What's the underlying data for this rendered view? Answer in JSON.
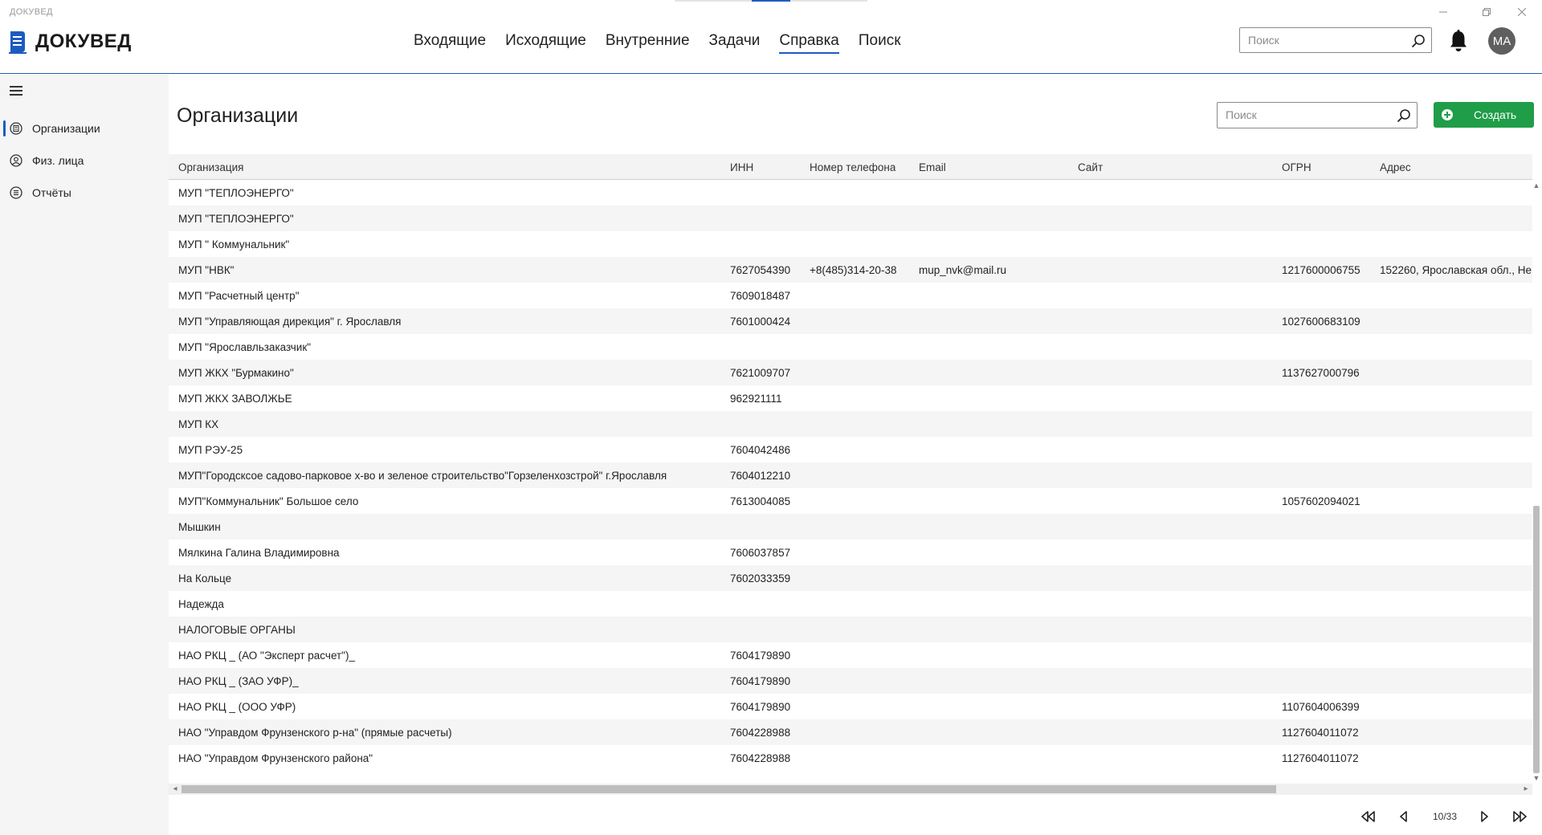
{
  "window": {
    "title": "ДОКУВЕД",
    "controls": [
      "minimize-icon",
      "restore-icon",
      "close-icon"
    ]
  },
  "header": {
    "logo_text": "ДОКУВЕД",
    "nav": [
      {
        "label": "Входящие"
      },
      {
        "label": "Исходящие"
      },
      {
        "label": "Внутренние"
      },
      {
        "label": "Задачи"
      },
      {
        "label": "Справка",
        "active": true
      },
      {
        "label": "Поиск"
      }
    ],
    "search_placeholder": "Поиск",
    "avatar_initials": "МА"
  },
  "sidebar": {
    "items": [
      {
        "label": "Организации",
        "icon": "building-icon",
        "active": true
      },
      {
        "label": "Физ. лица",
        "icon": "person-icon"
      },
      {
        "label": "Отчёты",
        "icon": "list-icon"
      }
    ]
  },
  "page": {
    "title": "Организации",
    "search_placeholder": "Поиск",
    "create_label": "Создать"
  },
  "table": {
    "columns": [
      "Организация",
      "ИНН",
      "Номер телефона",
      "Email",
      "Сайт",
      "ОГРН",
      "Адрес"
    ],
    "rows": [
      [
        "МУП  \"ТЕПЛОЭНЕРГО\"",
        "",
        "",
        "",
        "",
        "",
        ""
      ],
      [
        "МУП  \"ТЕПЛОЭНЕРГО\"",
        "",
        "",
        "",
        "",
        "",
        ""
      ],
      [
        "МУП \" Коммунальник\"",
        "",
        "",
        "",
        "",
        "",
        ""
      ],
      [
        "МУП \"НВК\"",
        "7627054390",
        "+8(485)314-20-38",
        "mup_nvk@mail.ru",
        "",
        "1217600006755",
        "152260, Ярославская обл., Не"
      ],
      [
        "МУП \"Расчетный центр\"",
        "7609018487",
        "",
        "",
        "",
        "",
        ""
      ],
      [
        "МУП \"Управляющая дирекция\" г. Ярославля",
        "7601000424",
        "",
        "",
        "",
        "1027600683109",
        ""
      ],
      [
        "МУП \"Ярославльзаказчик\"",
        "",
        "",
        "",
        "",
        "",
        ""
      ],
      [
        "МУП ЖКХ \"Бурмакино\"",
        "7621009707",
        "",
        "",
        "",
        "1137627000796",
        ""
      ],
      [
        "МУП ЖКХ ЗАВОЛЖЬЕ",
        "962921111",
        "",
        "",
        "",
        "",
        ""
      ],
      [
        "МУП КХ",
        "",
        "",
        "",
        "",
        "",
        ""
      ],
      [
        "МУП РЭУ-25",
        "7604042486",
        "",
        "",
        "",
        "",
        ""
      ],
      [
        "МУП\"Городсксое садово-парковое х-во и зеленое строительство\"Горзеленхозстрой\" г.Ярославля",
        "7604012210",
        "",
        "",
        "",
        "",
        ""
      ],
      [
        "МУП\"Коммунальник\" Большое село",
        "7613004085",
        "",
        "",
        "",
        "1057602094021",
        ""
      ],
      [
        "Мышкин",
        "",
        "",
        "",
        "",
        "",
        ""
      ],
      [
        "Мялкина Галина Владимировна",
        "7606037857",
        "",
        "",
        "",
        "",
        ""
      ],
      [
        "На Кольце",
        "7602033359",
        "",
        "",
        "",
        "",
        ""
      ],
      [
        "Надежда",
        "",
        "",
        "",
        "",
        "",
        ""
      ],
      [
        "НАЛОГОВЫЕ ОРГАНЫ",
        "",
        "",
        "",
        "",
        "",
        ""
      ],
      [
        "НАО  РКЦ _ (АО \"Эксперт расчет\")_",
        "7604179890",
        "",
        "",
        "",
        "",
        ""
      ],
      [
        "НАО  РКЦ _ (ЗАО УФР)_",
        "7604179890",
        "",
        "",
        "",
        "",
        ""
      ],
      [
        "НАО  РКЦ _ (ООО УФР)",
        "7604179890",
        "",
        "",
        "",
        "1107604006399",
        ""
      ],
      [
        "НАО \"Управдом Фрунзенского р-на\" (прямые расчеты)",
        "7604228988",
        "",
        "",
        "",
        "1127604011072",
        ""
      ],
      [
        "НАО \"Управдом Фрунзенского района\"",
        "7604228988",
        "",
        "",
        "",
        "1127604011072",
        ""
      ]
    ]
  },
  "pagination": {
    "page_info": "10/33"
  },
  "colors": {
    "accent": "#1e5bbf",
    "create_button": "#1f9d48",
    "row_alt": "#f5f5f5"
  }
}
